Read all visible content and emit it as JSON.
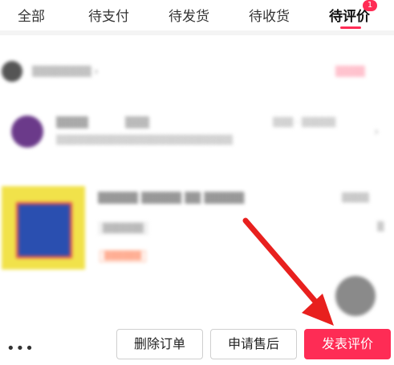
{
  "tabs": [
    {
      "label": "全部"
    },
    {
      "label": "待支付"
    },
    {
      "label": "待发货"
    },
    {
      "label": "待收货"
    },
    {
      "label": "待评价",
      "badge": "1",
      "active": true
    }
  ],
  "actions": {
    "delete_order": "删除订单",
    "after_sale": "申请售后",
    "post_review": "发表评价",
    "more": "•••"
  },
  "colors": {
    "accent": "#fe2c55",
    "arrow": "#e8201e"
  },
  "icons": {
    "more": "more-dots-icon",
    "chevron": "chevron-right-icon"
  }
}
